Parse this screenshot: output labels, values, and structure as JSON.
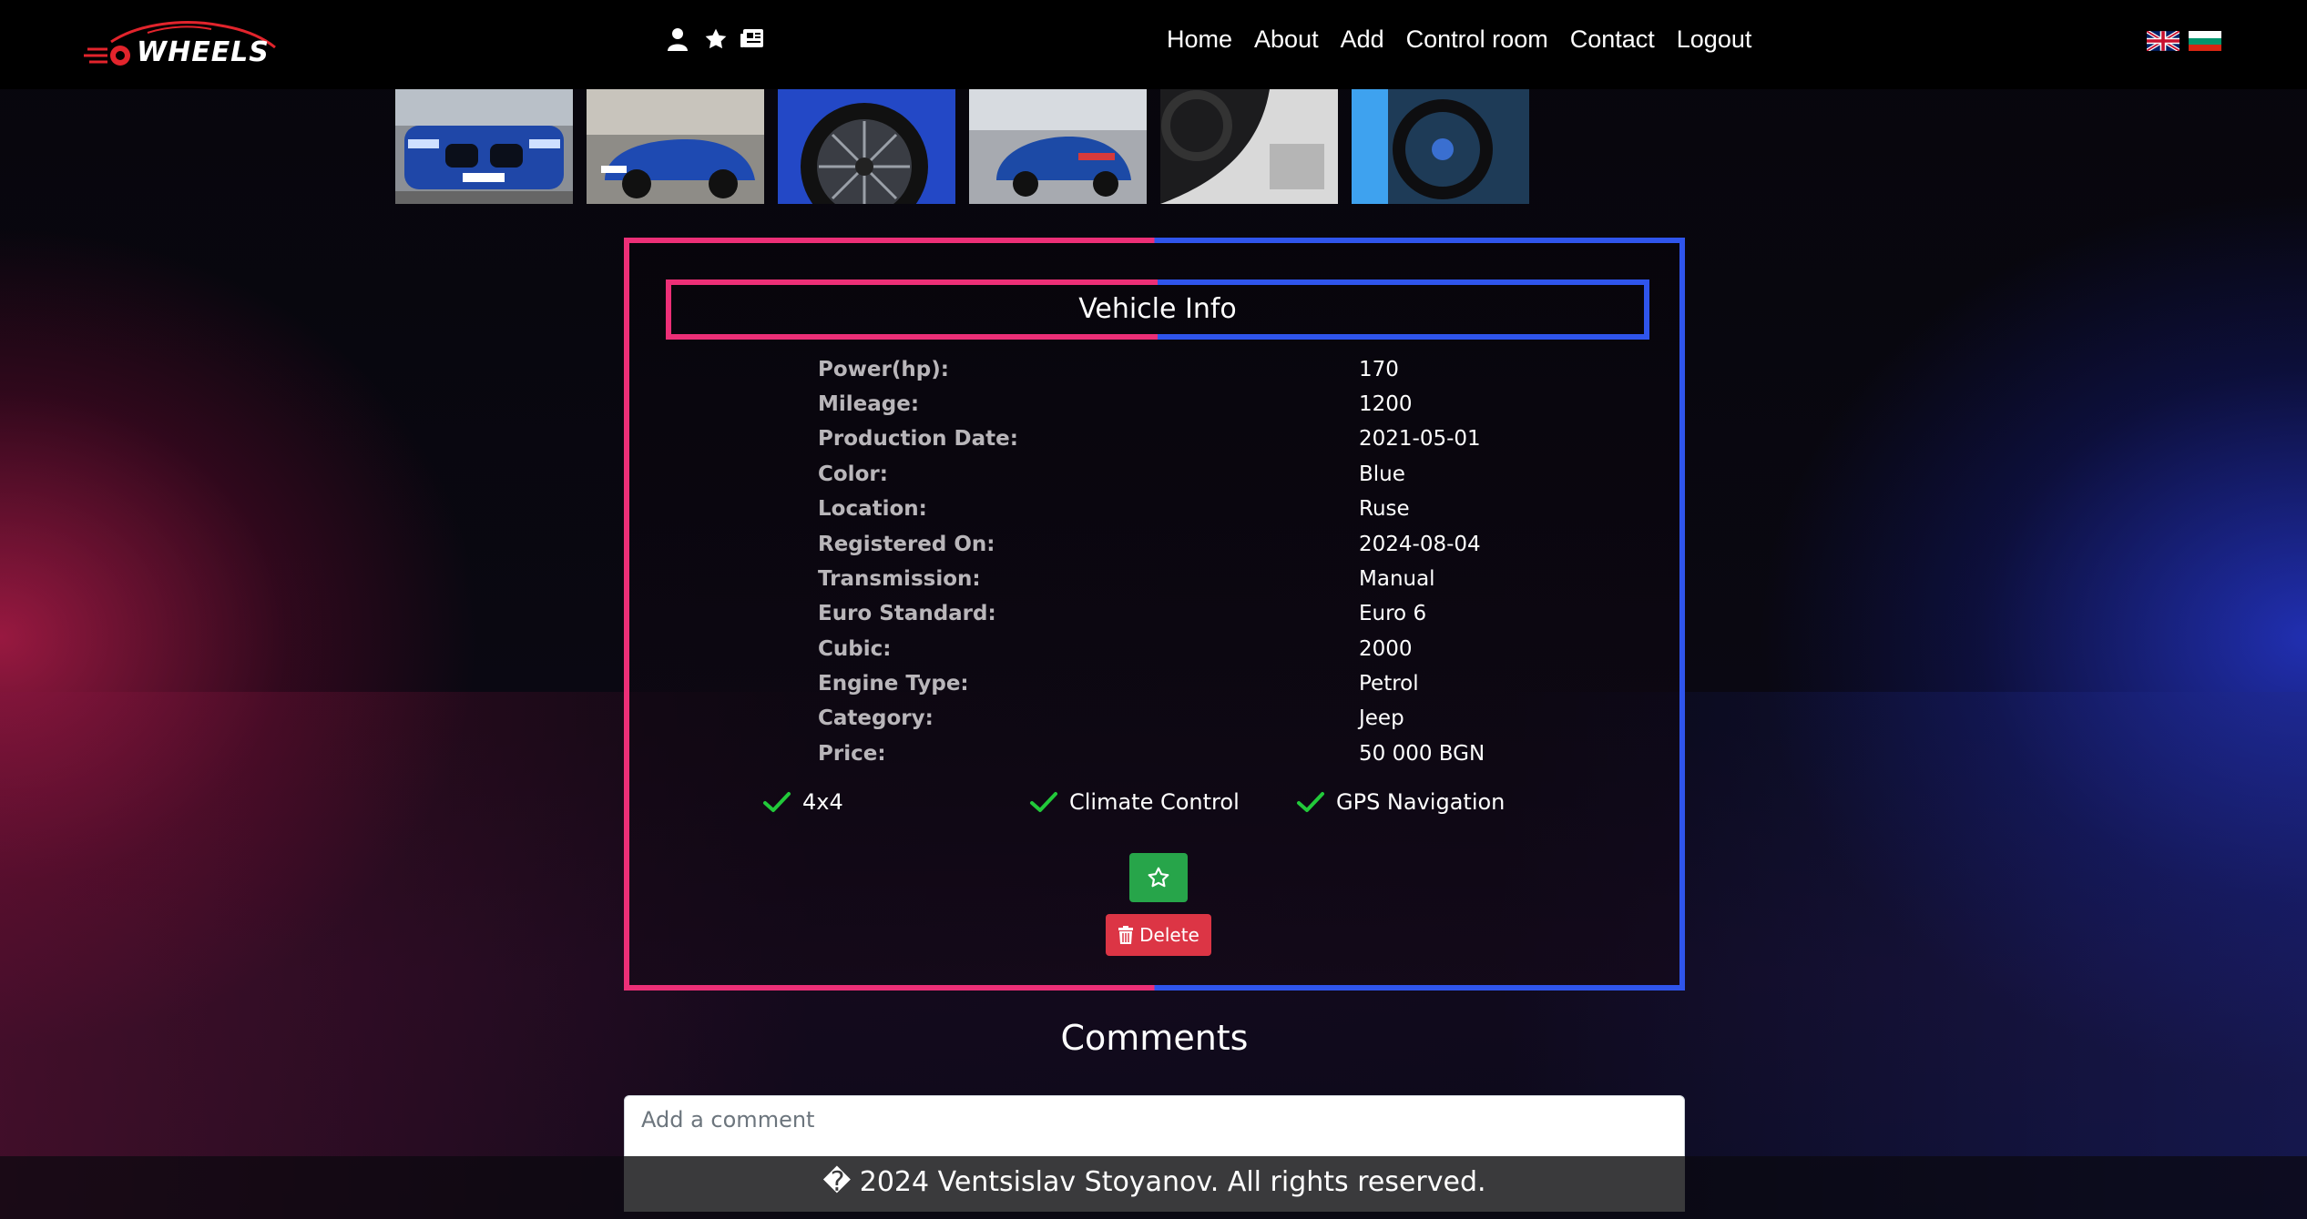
{
  "brand": {
    "logo_text": "WHEELS"
  },
  "nav": {
    "icons": [
      "user-icon",
      "star-icon",
      "newspaper-icon"
    ],
    "links": [
      "Home",
      "About",
      "Add",
      "Control room",
      "Contact",
      "Logout"
    ],
    "languages": [
      "English",
      "Bulgarian"
    ]
  },
  "gallery": {
    "thumbnails": [
      "front view",
      "side view",
      "wheel detail",
      "rear view",
      "interior view",
      "steering wheel"
    ]
  },
  "vehicle_info": {
    "title": "Vehicle Info",
    "specs": [
      {
        "label": "Power(hp):",
        "value": "170"
      },
      {
        "label": "Mileage:",
        "value": "1200"
      },
      {
        "label": "Production Date:",
        "value": "2021-05-01"
      },
      {
        "label": "Color:",
        "value": "Blue"
      },
      {
        "label": "Location:",
        "value": "Ruse"
      },
      {
        "label": "Registered On:",
        "value": "2024-08-04"
      },
      {
        "label": "Transmission:",
        "value": "Manual"
      },
      {
        "label": "Euro Standard:",
        "value": "Euro 6"
      },
      {
        "label": "Cubic:",
        "value": "2000"
      },
      {
        "label": "Engine Type:",
        "value": "Petrol"
      },
      {
        "label": "Category:",
        "value": "Jeep"
      },
      {
        "label": "Price:",
        "value": "50 000 BGN"
      }
    ],
    "features": [
      "4x4",
      "Climate Control",
      "GPS Navigation"
    ],
    "delete_label": "Delete"
  },
  "comments": {
    "title": "Comments",
    "placeholder": "Add a comment"
  },
  "footer": {
    "text": "� 2024 Ventsislav Stoyanov. All rights reserved."
  },
  "colors": {
    "accent_pink": "#ec2f77",
    "accent_blue": "#2f55ec",
    "success": "#27a54a",
    "danger": "#dc3545",
    "check": "#22c93a"
  }
}
